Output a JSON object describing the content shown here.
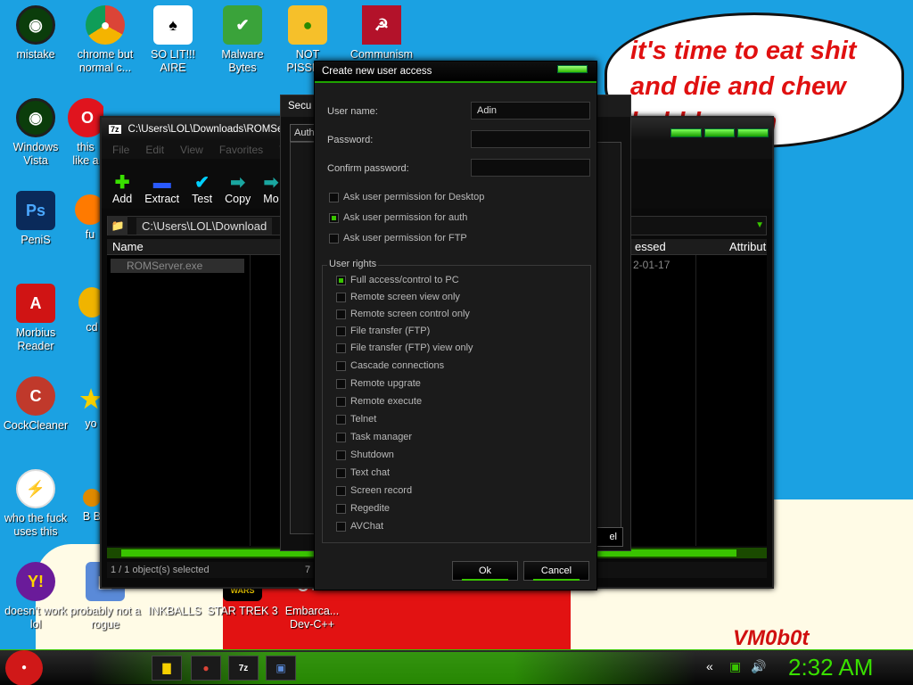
{
  "speech_bubble": {
    "text": "it's time to eat shit\nand die and chew\nbubble gum"
  },
  "wallpaper": {
    "signature": "VM0b0t"
  },
  "desktop_icons": [
    {
      "label": "mistake",
      "icon": "razer-icon"
    },
    {
      "label": "chrome but normal c...",
      "icon": "chrome-icon"
    },
    {
      "label": "SO LIT!!! AIRE",
      "icon": "solitaire-icon"
    },
    {
      "label": "Malware Bytes",
      "icon": "shield-icon"
    },
    {
      "label": "NOT PISSE...",
      "icon": "angry-birds-pig-icon"
    },
    {
      "label": "Communism",
      "icon": "communism-icon"
    },
    {
      "label": "Windows Vista",
      "icon": "razer-icon"
    },
    {
      "label": "this like a",
      "icon": "opera-icon"
    },
    {
      "label": "PeniS",
      "icon": "photoshop-icon"
    },
    {
      "label": "fu",
      "icon": "firefox-icon"
    },
    {
      "label": "Morbius Reader",
      "icon": "acrobat-icon"
    },
    {
      "label": "cd",
      "icon": "cd-icon"
    },
    {
      "label": "CockCleaner",
      "icon": "ccleaner-icon"
    },
    {
      "label": "yo",
      "icon": "star-icon"
    },
    {
      "label": "who the fuck uses this",
      "icon": "lightning-icon"
    },
    {
      "label": "B B",
      "icon": "app-icon"
    },
    {
      "label": "doesn't work lol",
      "icon": "yahoo-messenger-icon"
    },
    {
      "label": "probably not a rogue",
      "icon": "computer-icon"
    },
    {
      "label": "INKBALLS",
      "icon": "inkball-icon"
    },
    {
      "label": "STAR TREK 3",
      "icon": "star-wars-icon"
    },
    {
      "label": "Embarca... Dev-C++",
      "icon": "dev-cpp-icon"
    }
  ],
  "sevenzip": {
    "title": "C:\\Users\\LOL\\Downloads\\ROMServ",
    "menu": [
      "File",
      "Edit",
      "View",
      "Favorites",
      "T"
    ],
    "tools": [
      {
        "label": "Add",
        "icon": "plus-icon"
      },
      {
        "label": "Extract",
        "icon": "minus-icon"
      },
      {
        "label": "Test",
        "icon": "check-icon"
      },
      {
        "label": "Copy",
        "icon": "arrow-right-icon"
      },
      {
        "label": "Mo",
        "icon": "move-icon"
      }
    ],
    "address": "C:\\Users\\LOL\\Download",
    "columns": {
      "name": "Name",
      "accessed": "essed",
      "attributes": "Attribut"
    },
    "file": {
      "name": "ROMServer.exe",
      "date": "2-01-17"
    },
    "status_left": "1 / 1 object(s) selected",
    "status_right": "7"
  },
  "security_window": {
    "title": "Secu",
    "tab": "Auth",
    "button": "el"
  },
  "dialog": {
    "title": "Create new user access",
    "fields": [
      {
        "label": "User name:",
        "value": "Adin"
      },
      {
        "label": "Password:",
        "value": ""
      },
      {
        "label": "Confirm password:",
        "value": ""
      }
    ],
    "permissions": [
      {
        "label": "Ask user permission for Desktop",
        "checked": false
      },
      {
        "label": "Ask user permission for auth",
        "checked": true
      },
      {
        "label": "Ask user permission for FTP",
        "checked": false
      }
    ],
    "rights_label": "User rights",
    "rights": [
      {
        "label": "Full access/control to PC",
        "checked": true
      },
      {
        "label": "Remote screen view only",
        "checked": false
      },
      {
        "label": "Remote screen control only",
        "checked": false
      },
      {
        "label": "File transfer (FTP)",
        "checked": false
      },
      {
        "label": "File transfer (FTP) view only",
        "checked": false
      },
      {
        "label": "Cascade connections",
        "checked": false
      },
      {
        "label": "Remote upgrate",
        "checked": false
      },
      {
        "label": "Remote execute",
        "checked": false
      },
      {
        "label": "Telnet",
        "checked": false
      },
      {
        "label": "Task manager",
        "checked": false
      },
      {
        "label": "Shutdown",
        "checked": false
      },
      {
        "label": "Text chat",
        "checked": false
      },
      {
        "label": "Screen record",
        "checked": false
      },
      {
        "label": "Regedite",
        "checked": false
      },
      {
        "label": "AVChat",
        "checked": false
      }
    ],
    "ok_label": "Ok",
    "cancel_label": "Cancel"
  },
  "taskbar": {
    "clock": "2:32 AM",
    "logo": "7z",
    "tray_icons": [
      "chevron-icon",
      "monitor-icon",
      "speaker-icon"
    ],
    "accent": "#39c400"
  }
}
